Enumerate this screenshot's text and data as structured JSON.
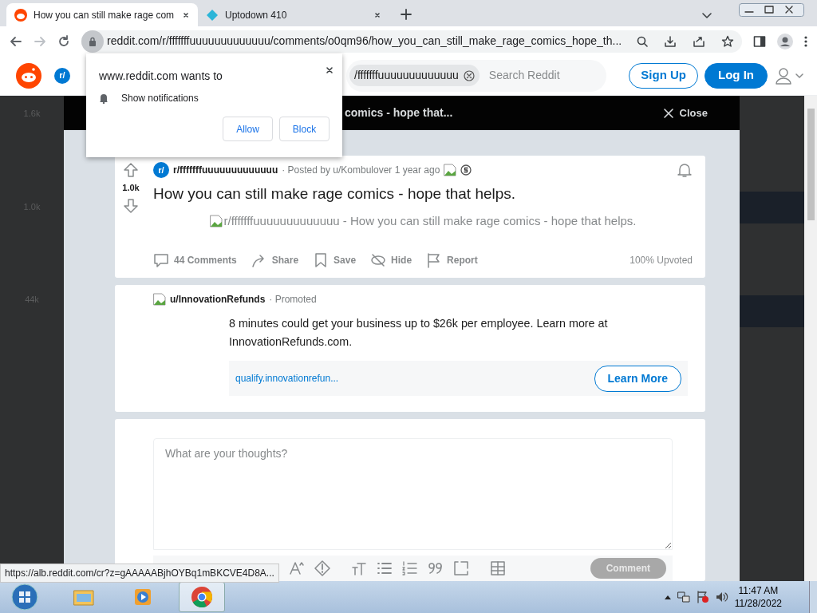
{
  "browser": {
    "tabs": [
      {
        "title": "How you can still make rage com",
        "selected": true
      },
      {
        "title": "Uptodown 410",
        "selected": false
      }
    ],
    "url": "reddit.com/r/fffffffuuuuuuuuuuuuu/comments/o0qm96/how_you_can_still_make_rage_comics_hope_th...",
    "status_url": "https://alb.reddit.com/cr?z=gAAAAABjhOYBq1mBKCVE4D8A..."
  },
  "permission_prompt": {
    "title": "www.reddit.com wants to",
    "permission": "Show notifications",
    "buttons": [
      "Allow",
      "Block"
    ]
  },
  "header": {
    "community_icon": "r/",
    "search_chip": "/fffffffuuuuuuuuuuuuu",
    "search_placeholder": "Search Reddit",
    "buttons": [
      {
        "label": "Sign Up",
        "kind": "outline"
      },
      {
        "label": "Log In",
        "kind": "solid"
      }
    ]
  },
  "background_scores": [
    "1.6k",
    "1.0k",
    "44k"
  ],
  "modal": {
    "title": "comics - hope that...",
    "close": "Close"
  },
  "post": {
    "community_icon": "r/",
    "subreddit": "r/fffffffuuuuuuuuuuuuu",
    "byline": "· Posted by u/Kombulover 1 year ago",
    "score": "1.0k",
    "title": "How you can still make rage comics - hope that helps.",
    "image_alt": "r/fffffffuuuuuuuuuuuuu - How you can still make rage comics - hope that helps.",
    "actions": [
      {
        "label": "44 Comments",
        "kind": "comment"
      },
      {
        "label": "Share",
        "kind": "share"
      },
      {
        "label": "Save",
        "kind": "save"
      },
      {
        "label": "Hide",
        "kind": "hide"
      },
      {
        "label": "Report",
        "kind": "report"
      }
    ],
    "upvoted": "100% Upvoted"
  },
  "ad": {
    "user": "u/InnovationRefunds",
    "tag": "· Promoted",
    "text": "8 minutes could get your business up to $26k per employee. Learn more at InnovationRefunds.com.",
    "link": "qualify.innovationrefun...",
    "button": "Learn More"
  },
  "comment_box": {
    "placeholder": "What are your thoughts?",
    "submit": "Comment",
    "disabled": true
  },
  "taskbar": {
    "apps": [
      {
        "kind": "explorer",
        "selected": false
      },
      {
        "kind": "media",
        "selected": false
      },
      {
        "kind": "chrome",
        "selected": true
      }
    ],
    "time": "11:47 AM",
    "date": "11/28/2022"
  }
}
